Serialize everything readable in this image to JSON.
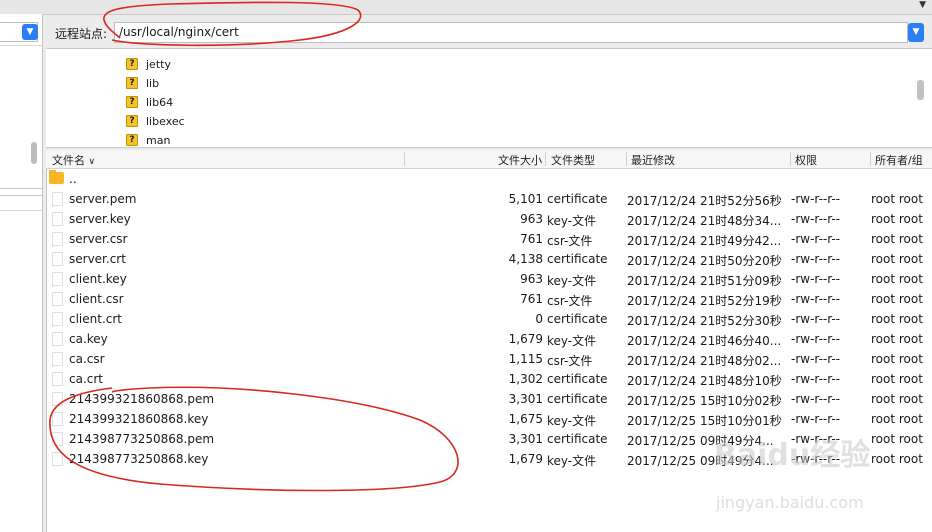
{
  "top": {
    "caret": "▼"
  },
  "left_pane": {
    "dropdown_icon": "chevron-down-icon"
  },
  "remote": {
    "label": "远程站点:",
    "path": "/usr/local/nginx/cert"
  },
  "tree": {
    "items": [
      {
        "label": "jetty",
        "icon": "unknown-folder-icon"
      },
      {
        "label": "lib",
        "icon": "unknown-folder-icon"
      },
      {
        "label": "lib64",
        "icon": "unknown-folder-icon"
      },
      {
        "label": "libexec",
        "icon": "unknown-folder-icon"
      },
      {
        "label": "man",
        "icon": "unknown-folder-icon"
      }
    ]
  },
  "filelist": {
    "headers": {
      "name": "文件名",
      "size": "文件大小",
      "type": "文件类型",
      "modified": "最近修改",
      "perm": "权限",
      "owner": "所有者/组"
    },
    "parent_dir": "..",
    "rows": [
      {
        "name": "server.pem",
        "size": "5,101",
        "type": "certificate",
        "modified": "2017/12/24 21时52分56秒",
        "perm": "-rw-r--r--",
        "owner": "root root"
      },
      {
        "name": "server.key",
        "size": "963",
        "type": "key-文件",
        "modified": "2017/12/24 21时48分34...",
        "perm": "-rw-r--r--",
        "owner": "root root"
      },
      {
        "name": "server.csr",
        "size": "761",
        "type": "csr-文件",
        "modified": "2017/12/24 21时49分42...",
        "perm": "-rw-r--r--",
        "owner": "root root"
      },
      {
        "name": "server.crt",
        "size": "4,138",
        "type": "certificate",
        "modified": "2017/12/24 21时50分20秒",
        "perm": "-rw-r--r--",
        "owner": "root root"
      },
      {
        "name": "client.key",
        "size": "963",
        "type": "key-文件",
        "modified": "2017/12/24 21时51分09秒",
        "perm": "-rw-r--r--",
        "owner": "root root"
      },
      {
        "name": "client.csr",
        "size": "761",
        "type": "csr-文件",
        "modified": "2017/12/24 21时52分19秒",
        "perm": "-rw-r--r--",
        "owner": "root root"
      },
      {
        "name": "client.crt",
        "size": "0",
        "type": "certificate",
        "modified": "2017/12/24 21时52分30秒",
        "perm": "-rw-r--r--",
        "owner": "root root"
      },
      {
        "name": "ca.key",
        "size": "1,679",
        "type": "key-文件",
        "modified": "2017/12/24 21时46分40...",
        "perm": "-rw-r--r--",
        "owner": "root root"
      },
      {
        "name": "ca.csr",
        "size": "1,115",
        "type": "csr-文件",
        "modified": "2017/12/24 21时48分02...",
        "perm": "-rw-r--r--",
        "owner": "root root"
      },
      {
        "name": "ca.crt",
        "size": "1,302",
        "type": "certificate",
        "modified": "2017/12/24 21时48分10秒",
        "perm": "-rw-r--r--",
        "owner": "root root"
      },
      {
        "name": "214399321860868.pem",
        "size": "3,301",
        "type": "certificate",
        "modified": "2017/12/25 15时10分02秒",
        "perm": "-rw-r--r--",
        "owner": "root root"
      },
      {
        "name": "214399321860868.key",
        "size": "1,675",
        "type": "key-文件",
        "modified": "2017/12/25 15时10分01秒",
        "perm": "-rw-r--r--",
        "owner": "root root"
      },
      {
        "name": "214398773250868.pem",
        "size": "3,301",
        "type": "certificate",
        "modified": "2017/12/25 09时49分4...",
        "perm": "-rw-r--r--",
        "owner": "root root"
      },
      {
        "name": "214398773250868.key",
        "size": "1,679",
        "type": "key-文件",
        "modified": "2017/12/25 09时49分4...",
        "perm": "-rw-r--r--",
        "owner": "root root"
      }
    ]
  },
  "watermark": {
    "logo": "Baidu经验",
    "url": "jingyan.baidu.com"
  },
  "colors": {
    "accent": "#2b7ef5",
    "annotation": "#d8281f",
    "folder": "#f7b527"
  }
}
